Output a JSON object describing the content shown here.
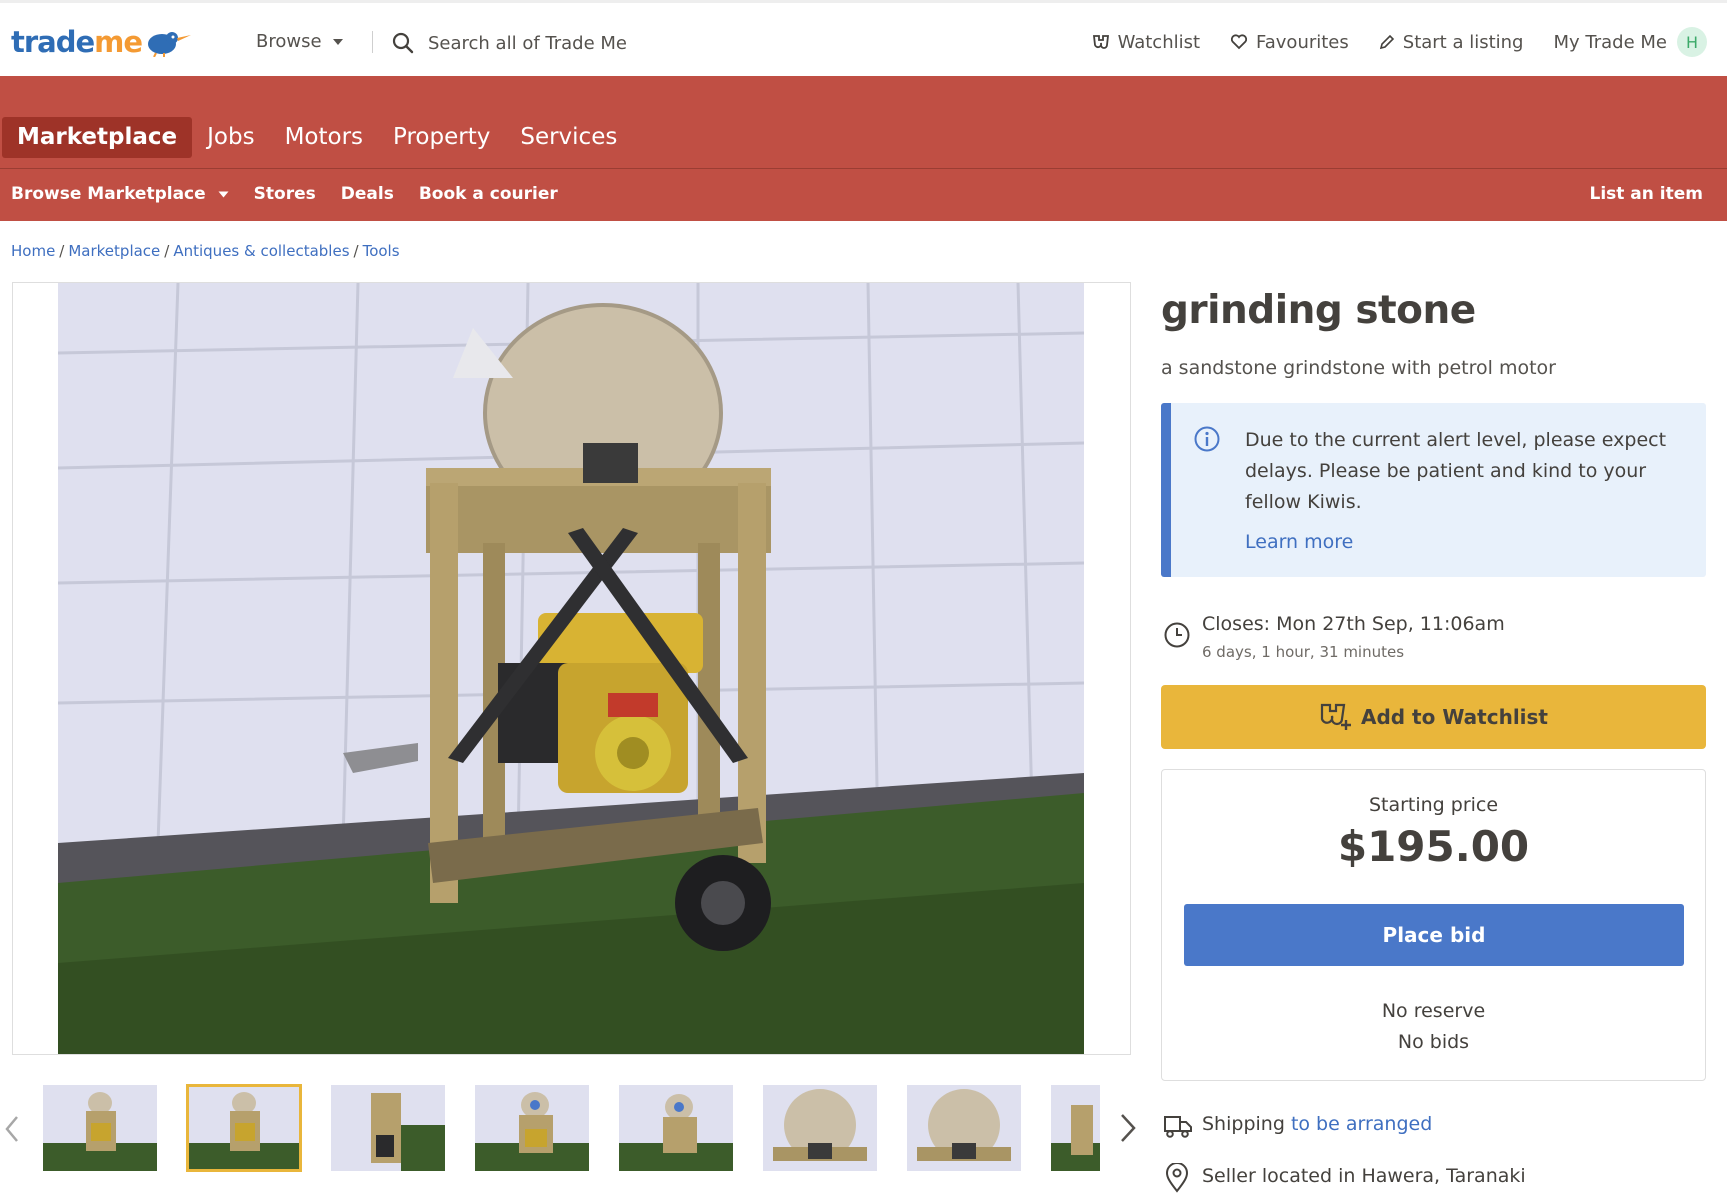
{
  "logo": {
    "part1": "trade",
    "part2": "me"
  },
  "header": {
    "browse_label": "Browse",
    "search_placeholder": "Search all of Trade Me",
    "watchlist": "Watchlist",
    "favourites": "Favourites",
    "start_listing": "Start a listing",
    "my_trade_me": "My Trade Me",
    "avatar_initial": "H"
  },
  "verticals": [
    {
      "label": "Marketplace",
      "active": true
    },
    {
      "label": "Jobs"
    },
    {
      "label": "Motors"
    },
    {
      "label": "Property"
    },
    {
      "label": "Services"
    }
  ],
  "subnav": {
    "browse_marketplace": "Browse Marketplace",
    "stores": "Stores",
    "deals": "Deals",
    "book_courier": "Book a courier",
    "list_item": "List an item"
  },
  "breadcrumb": [
    "Home",
    "Marketplace",
    "Antiques & collectables",
    "Tools"
  ],
  "listing": {
    "title": "grinding stone",
    "subtitle": "a sandstone grindstone with petrol motor",
    "alert_text": "Due to the current alert level, please expect delays. Please be patient and kind to your fellow Kiwis.",
    "alert_link": "Learn more",
    "closes": "Closes: Mon 27th Sep, 11:06am",
    "closes_remaining": "6 days, 1 hour, 31 minutes",
    "watchlist_button": "Add to Watchlist",
    "price_label": "Starting price",
    "price": "$195.00",
    "bid_button": "Place bid",
    "reserve": "No reserve",
    "bids": "No bids",
    "shipping_prefix": "Shipping",
    "shipping_link": "to be arranged",
    "location": "Seller located in Hawera, Taranaki"
  },
  "thumbnails": {
    "count": 8,
    "selected_index": 1
  },
  "colors": {
    "nav_red": "#c04f44",
    "nav_active": "#9e3328",
    "link_blue": "#3f6fc0",
    "bid_blue": "#4a78c9",
    "watch_yellow": "#e9b63b",
    "alert_bg": "#e8f1fb"
  },
  "icons": {
    "search": "search-icon",
    "watchlist": "binoculars-icon",
    "favourites": "heart-icon",
    "listing": "pencil-icon",
    "info": "info-icon",
    "clock": "clock-icon",
    "shipping": "truck-icon",
    "location": "map-pin-icon"
  }
}
